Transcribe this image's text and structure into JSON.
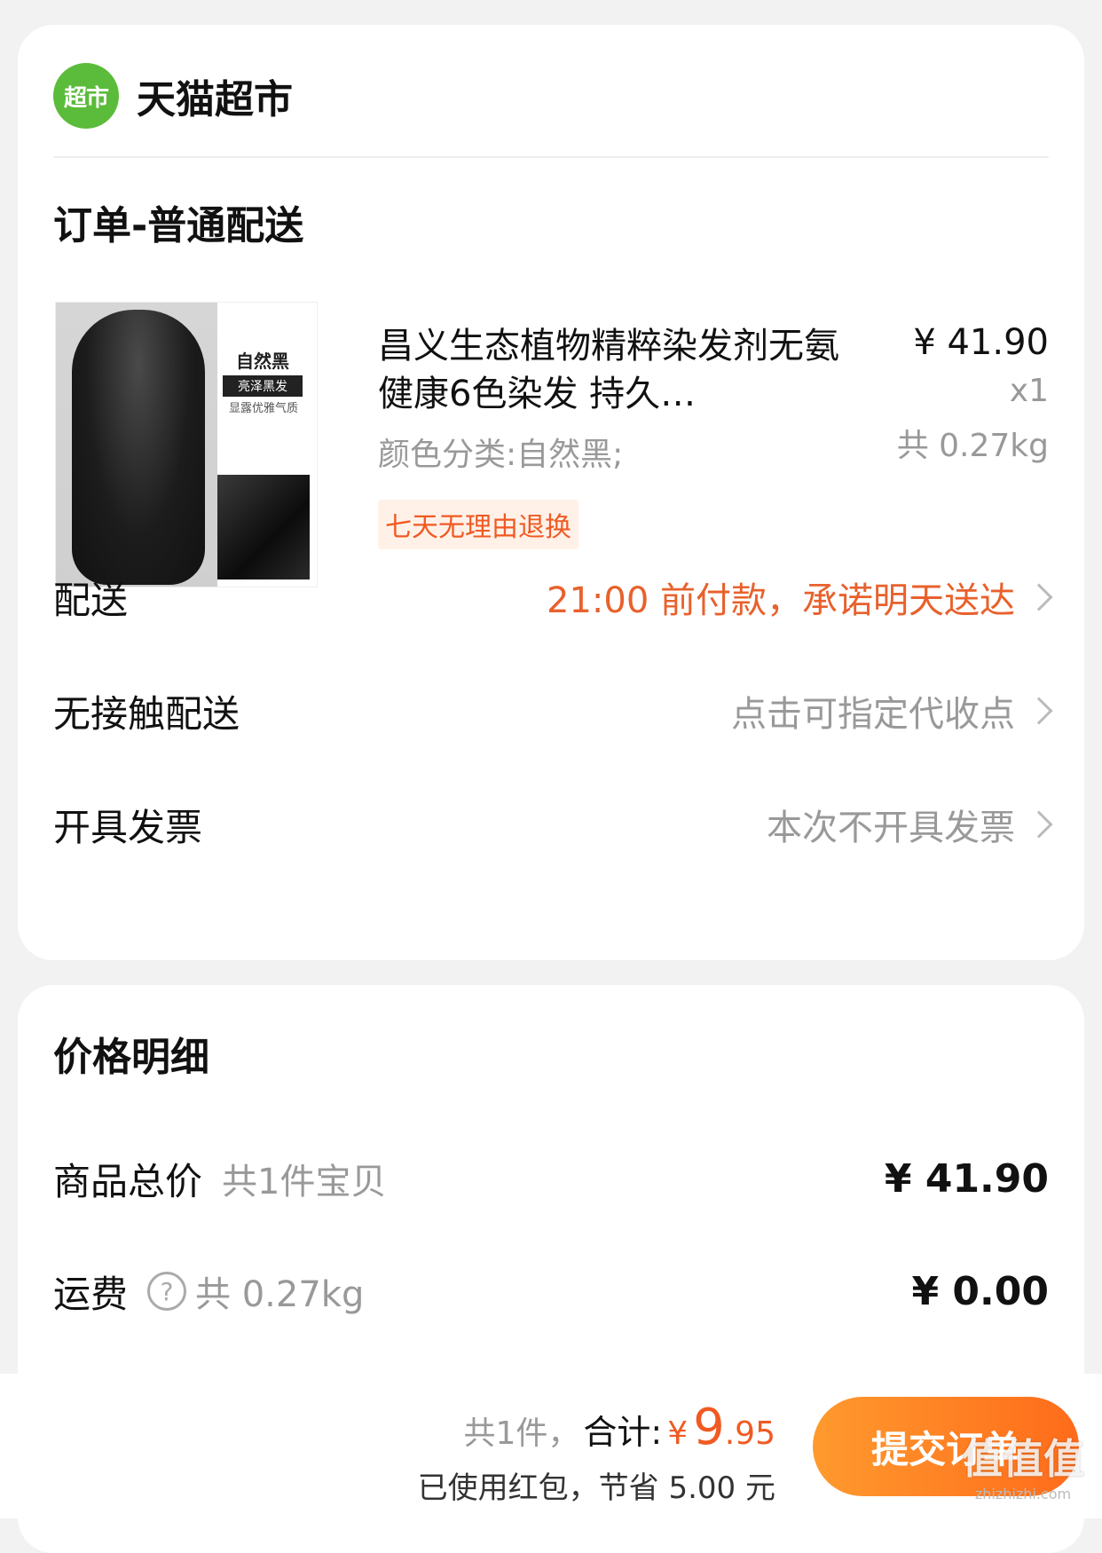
{
  "store": {
    "logo_text": "超市",
    "name": "天猫超市"
  },
  "order": {
    "title": "订单-普通配送"
  },
  "product": {
    "title": "昌义生态植物精粹染发剂无氨健康6色染发 持久…",
    "spec": "颜色分类:自然黑;",
    "tag": "七天无理由退换",
    "price": "¥ 41.90",
    "qty": "x1",
    "weight": "共 0.27kg",
    "image_text": {
      "color_name": "自然黑",
      "badge": "亮泽黑发",
      "caption": "显露优雅气质"
    }
  },
  "options": {
    "delivery": {
      "label": "配送",
      "value": "21:00 前付款，承诺明天送达"
    },
    "contactless": {
      "label": "无接触配送",
      "value": "点击可指定代收点"
    },
    "invoice": {
      "label": "开具发票",
      "value": "本次不开具发票"
    }
  },
  "price_detail": {
    "title": "价格明细",
    "goods": {
      "label": "商品总价",
      "sub": "共1件宝贝",
      "amount": "¥ 41.90"
    },
    "shipping": {
      "label": "运费",
      "sub": "共 0.27kg",
      "amount": "¥ 0.00"
    }
  },
  "bottom": {
    "count": "共1件，",
    "total_label": "合计:",
    "yen": "¥",
    "total_int": "9",
    "total_dec": ".95",
    "saving": "已使用红包，节省 5.00 元",
    "submit_label": "提交订单"
  },
  "watermark": {
    "big": "值值值",
    "small": "zhizhizhi.com"
  },
  "colors": {
    "accent": "#f05a22",
    "store_green": "#5bbb3a",
    "button_start": "#ff9a2e",
    "button_end": "#ff6b1a"
  }
}
